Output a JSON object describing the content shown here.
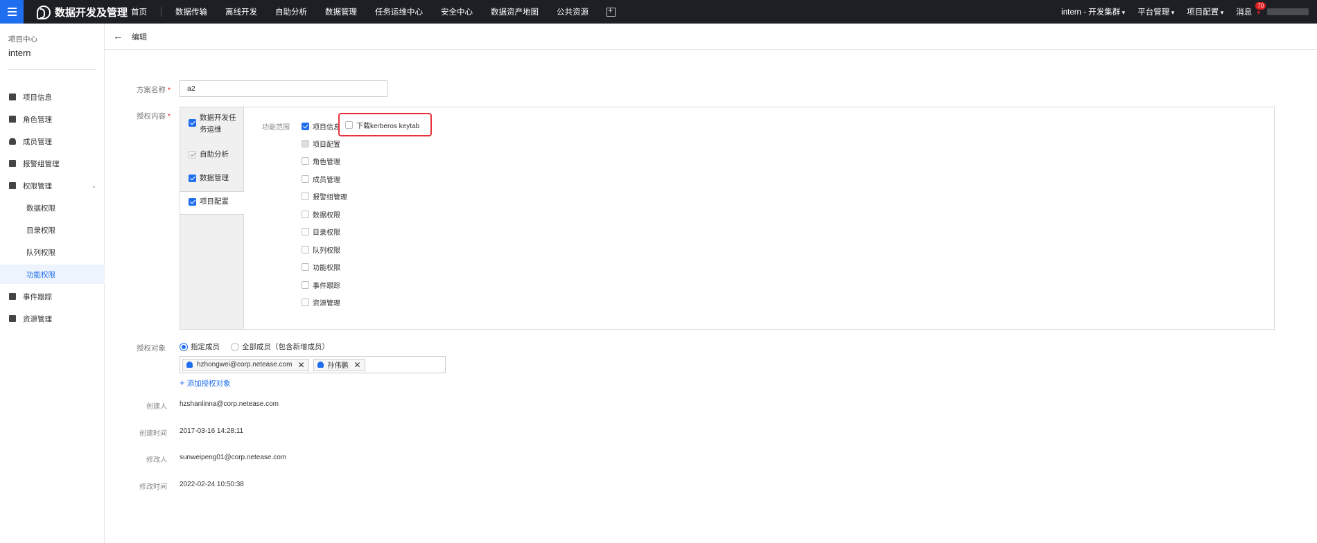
{
  "topbar": {
    "app_title": "数据开发及管理",
    "nav": [
      "首页",
      "数据传输",
      "离线开发",
      "自助分析",
      "数据管理",
      "任务运维中心",
      "安全中心",
      "数据资产地图",
      "公共资源"
    ],
    "cluster": "intern - 开发集群",
    "platform": "平台管理",
    "project_config": "项目配置",
    "messages": "消息",
    "message_count": "70"
  },
  "sidebar": {
    "section_label": "项目中心",
    "project_name": "intern",
    "items": [
      {
        "label": "项目信息",
        "icon": "file-icon"
      },
      {
        "label": "角色管理",
        "icon": "role-icon"
      },
      {
        "label": "成员管理",
        "icon": "user-icon"
      },
      {
        "label": "报警组管理",
        "icon": "alarm-icon"
      },
      {
        "label": "权限管理",
        "icon": "lock-icon"
      },
      {
        "label": "数据权限"
      },
      {
        "label": "目录权限"
      },
      {
        "label": "队列权限"
      },
      {
        "label": "功能权限"
      },
      {
        "label": "事件跟踪",
        "icon": "event-icon"
      },
      {
        "label": "资源管理",
        "icon": "resource-icon"
      }
    ],
    "active": "功能权限"
  },
  "page": {
    "title": "编辑",
    "labels": {
      "scheme_name": "方案名称",
      "auth_content": "授权内容",
      "scope": "功能范围",
      "auth_target": "授权对象",
      "creator": "创建人",
      "create_time": "创建时间",
      "modifier": "修改人",
      "modify_time": "修改时间"
    },
    "scheme_name_value": "a2",
    "categories": [
      {
        "label": "数据开发任务运维",
        "state": "checked"
      },
      {
        "label": "自助分析",
        "state": "disabled-checked"
      },
      {
        "label": "数据管理",
        "state": "checked"
      },
      {
        "label": "项目配置",
        "state": "checked"
      }
    ],
    "permissions": [
      {
        "label": "项目信息",
        "state": "checked"
      },
      {
        "label": "项目配置",
        "state": "gray"
      },
      {
        "label": "角色管理",
        "state": "unchecked"
      },
      {
        "label": "成员管理",
        "state": "unchecked"
      },
      {
        "label": "报警组管理",
        "state": "unchecked"
      },
      {
        "label": "数据权限",
        "state": "unchecked"
      },
      {
        "label": "目录权限",
        "state": "unchecked"
      },
      {
        "label": "队列权限",
        "state": "unchecked"
      },
      {
        "label": "功能权限",
        "state": "unchecked"
      },
      {
        "label": "事件跟踪",
        "state": "unchecked"
      },
      {
        "label": "资源管理",
        "state": "unchecked"
      }
    ],
    "kerberos_option": "下载kerberos keytab",
    "radio_specified": "指定成员",
    "radio_all": "全部成员（包含新增成员）",
    "members": [
      "hzhongwei@corp.netease.com",
      "孙伟鹏"
    ],
    "add_target": "添加授权对象",
    "creator_value": "hzshanlinna@corp.netease.com",
    "create_time_value": "2017-03-16 14:28:11",
    "modifier_value": "sunweipeng01@corp.netease.com",
    "modify_time_value": "2022-02-24 10:50:38"
  },
  "colors": {
    "accent": "#1f6ef0",
    "topbar": "#1d1f24",
    "highlight": "#e8323c"
  }
}
